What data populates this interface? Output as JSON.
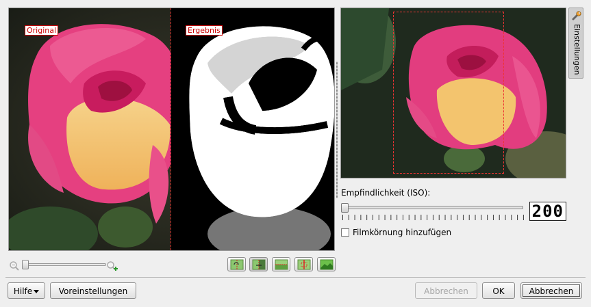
{
  "preview": {
    "original_label": "Original",
    "result_label": "Ergebnis"
  },
  "sidebar": {
    "tab_label": "Einstellungen",
    "tab_icon": "wrench-icon"
  },
  "settings": {
    "iso_label": "Empfindlichkeit (ISO):",
    "iso_value": "200",
    "iso_slider_fraction": 0.0,
    "film_grain_label": "Filmkörnung hinzufügen",
    "film_grain_checked": false
  },
  "zoom": {
    "zoom_out_icon": "zoom-out-icon",
    "zoom_in_icon": "zoom-in-icon",
    "level_fraction": 0.0
  },
  "view_modes": [
    {
      "name": "view-original-icon"
    },
    {
      "name": "view-split-vertical-icon",
      "active": true
    },
    {
      "name": "view-split-horizontal-icon"
    },
    {
      "name": "view-side-by-side-icon"
    },
    {
      "name": "view-result-icon"
    }
  ],
  "buttons": {
    "help": "Hilfe",
    "presets": "Voreinstellungen",
    "cancel_disabled": "Abbrechen",
    "ok": "OK",
    "cancel": "Abbrechen"
  },
  "colors": {
    "marker_red": "#d22222",
    "rose_pink": "#e0306f",
    "rose_yellow": "#f3c26a"
  }
}
